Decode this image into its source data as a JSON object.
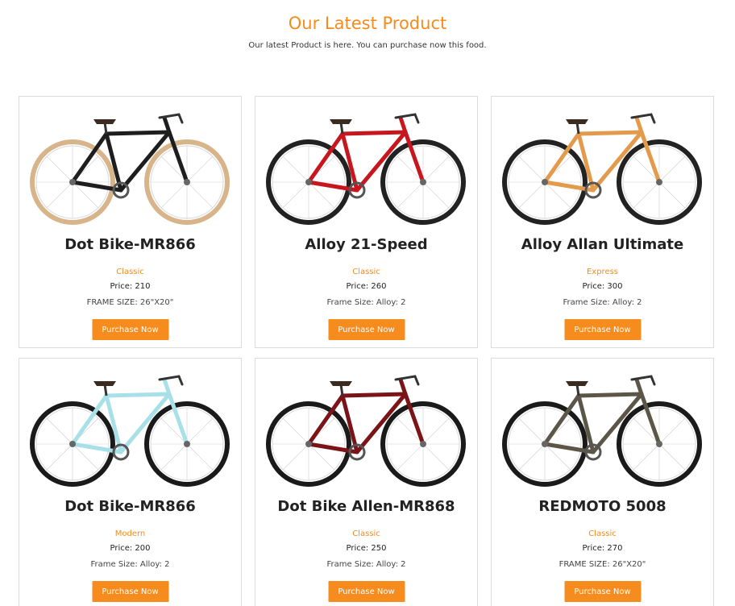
{
  "header": {
    "title": "Our Latest Product",
    "subtitle": "Our latest Product is here. You can purchase now this food."
  },
  "products": [
    {
      "name": "Dot Bike-MR866",
      "category": "Classic",
      "price": "Price: 210",
      "frame": "FRAME SIZE: 26\"X20\"",
      "button": "Purchase Now",
      "image": "black-city-bike",
      "color": "#1e1e1e",
      "tire": "#d8b48a"
    },
    {
      "name": "Alloy 21-Speed",
      "category": "Classic",
      "price": "Price: 260",
      "frame": "Frame Size: Alloy: 2",
      "button": "Purchase Now",
      "image": "red-white-road-bike",
      "color": "#c8161e",
      "tire": "#222222"
    },
    {
      "name": "Alloy Allan Ultimate",
      "category": "Express",
      "price": "Price: 300",
      "frame": "Frame Size: Alloy: 2",
      "button": "Purchase Now",
      "image": "orange-cruiser-bike",
      "color": "#e39a4a",
      "tire": "#222222"
    },
    {
      "name": "Dot Bike-MR866",
      "category": "Modern",
      "price": "Price: 200",
      "frame": "Frame Size: Alloy: 2",
      "button": "Purchase Now",
      "image": "light-blue-road-bike",
      "color": "#a8e0e8",
      "tire": "#1a1a1a"
    },
    {
      "name": "Dot Bike Allen-MR868",
      "category": "Classic",
      "price": "Price: 250",
      "frame": "Frame Size: Alloy: 2",
      "button": "Purchase Now",
      "image": "maroon-hybrid-bike",
      "color": "#7a1418",
      "tire": "#1a1a1a"
    },
    {
      "name": "REDMOTO 5008",
      "category": "Classic",
      "price": "Price: 270",
      "frame": "FRAME SIZE: 26\"X20\"",
      "button": "Purchase Now",
      "image": "grey-touring-bike",
      "color": "#5b5648",
      "tire": "#1a1a1a"
    }
  ]
}
